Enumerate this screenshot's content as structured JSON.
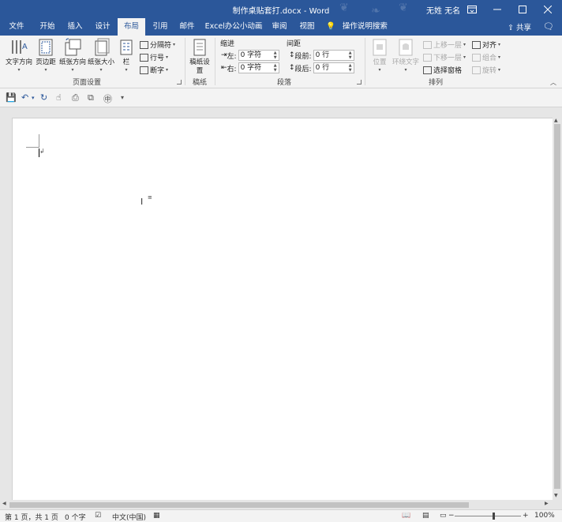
{
  "titlebar": {
    "title": "制作桌贴套打.docx  -  Word",
    "user": "无姓 无名"
  },
  "tabs": [
    {
      "label": "文件"
    },
    {
      "label": "开始"
    },
    {
      "label": "插入"
    },
    {
      "label": "设计"
    },
    {
      "label": "布局"
    },
    {
      "label": "引用"
    },
    {
      "label": "邮件"
    },
    {
      "label": "Excel办公小动画"
    },
    {
      "label": "审阅"
    },
    {
      "label": "视图"
    },
    {
      "label": "操作说明搜索"
    }
  ],
  "share_label": "共享",
  "ribbon": {
    "page_setup": {
      "text_direction": "文字方向",
      "margins": "页边距",
      "orientation": "纸张方向",
      "size": "纸张大小",
      "columns": "栏",
      "breaks": "分隔符",
      "line_numbers": "行号",
      "hyphenation": "断字",
      "group_label": "页面设置"
    },
    "manuscript": {
      "button": "稿纸设置",
      "group_label": "稿纸"
    },
    "paragraph": {
      "indent_label": "缩进",
      "spacing_label": "间距",
      "left_label": "左:",
      "right_label": "右:",
      "before_label": "段前:",
      "after_label": "段后:",
      "left_value": "0 字符",
      "right_value": "0 字符",
      "before_value": "0 行",
      "after_value": "0 行",
      "group_label": "段落"
    },
    "arrange": {
      "position": "位置",
      "wrap_text": "环绕文字",
      "bring_forward": "上移一层",
      "send_backward": "下移一层",
      "selection_pane": "选择窗格",
      "align": "对齐",
      "group": "组合",
      "rotate": "旋转",
      "group_label": "排列"
    }
  },
  "status": {
    "page": "第 1 页，共 1 页",
    "words": "0 个字",
    "language": "中文(中国)",
    "zoom": "100%"
  },
  "colors": {
    "accent": "#2b579a",
    "ribbon_bg": "#f3f3f3"
  }
}
